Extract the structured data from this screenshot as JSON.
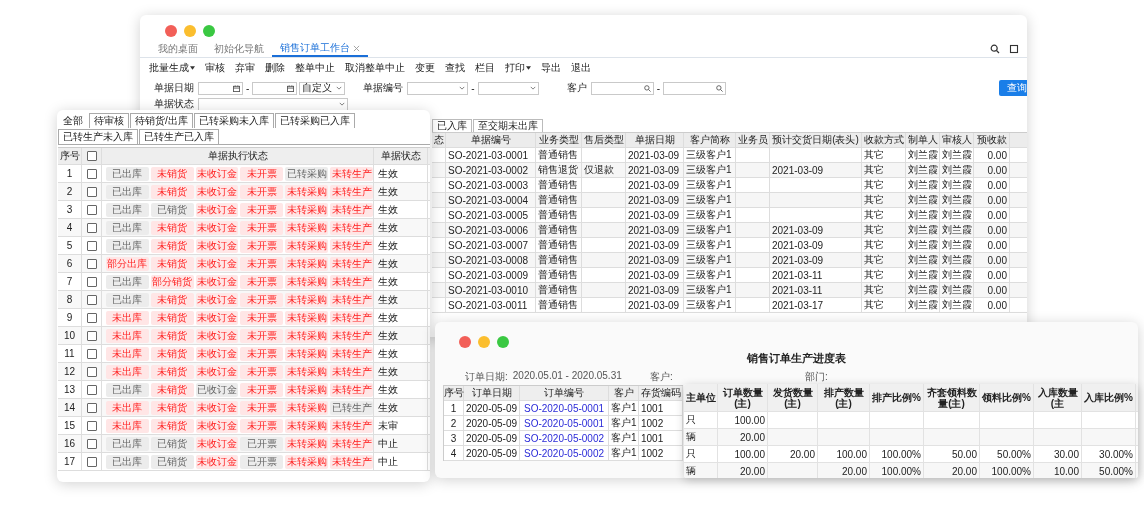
{
  "main_window": {
    "tabs": [
      {
        "label": "我的桌面",
        "selected": false,
        "closable": false
      },
      {
        "label": "初始化导航",
        "selected": false,
        "closable": false
      },
      {
        "label": "销售订单工作台",
        "selected": true,
        "closable": true
      }
    ],
    "toolbar": [
      {
        "label": "批量生成",
        "dropdown": true
      },
      {
        "label": "审核",
        "dropdown": false
      },
      {
        "label": "弃审",
        "dropdown": false
      },
      {
        "label": "删除",
        "dropdown": false
      },
      {
        "label": "整单中止",
        "dropdown": false
      },
      {
        "label": "取消整单中止",
        "dropdown": false
      },
      {
        "label": "变更",
        "dropdown": false
      },
      {
        "label": "查找",
        "dropdown": false
      },
      {
        "label": "栏目",
        "dropdown": false
      },
      {
        "label": "打印",
        "dropdown": true
      },
      {
        "label": "导出",
        "dropdown": false
      },
      {
        "label": "退出",
        "dropdown": false
      }
    ],
    "filters": [
      {
        "label": "单据日期",
        "kind": "date_range",
        "separator": "-",
        "preset": "自定义"
      },
      {
        "label": "单据编号",
        "kind": "select_range",
        "separator": "-"
      },
      {
        "label": "客户",
        "kind": "search_range",
        "separator": "-"
      },
      {
        "label": "单据状态",
        "kind": "select"
      }
    ],
    "query_button": "查询",
    "status_tabs": [
      {
        "label": "已入库",
        "selected": false
      },
      {
        "label": "至交期未出库",
        "selected": false
      }
    ],
    "table": {
      "columns": [
        "态",
        "单据编号",
        "业务类型",
        "售后类型",
        "单据日期",
        "客户简称",
        "业务员",
        "预计交货日期(表头)",
        "收款方式",
        "制单人",
        "审核人",
        "预收款"
      ],
      "rows": [
        [
          "",
          "SO-2021-03-0001",
          "普通销售",
          "",
          "2021-03-09",
          "三级客户1",
          "",
          "",
          "其它",
          "刘兰霞",
          "刘兰霞",
          "0.00"
        ],
        [
          "",
          "SO-2021-03-0002",
          "销售退货",
          "仅退款",
          "2021-03-09",
          "三级客户1",
          "",
          "2021-03-09",
          "其它",
          "刘兰霞",
          "刘兰霞",
          "0.00"
        ],
        [
          "",
          "SO-2021-03-0003",
          "普通销售",
          "",
          "2021-03-09",
          "三级客户1",
          "",
          "",
          "其它",
          "刘兰霞",
          "刘兰霞",
          "0.00"
        ],
        [
          "",
          "SO-2021-03-0004",
          "普通销售",
          "",
          "2021-03-09",
          "三级客户1",
          "",
          "",
          "其它",
          "刘兰霞",
          "刘兰霞",
          "0.00"
        ],
        [
          "",
          "SO-2021-03-0005",
          "普通销售",
          "",
          "2021-03-09",
          "三级客户1",
          "",
          "",
          "其它",
          "刘兰霞",
          "刘兰霞",
          "0.00"
        ],
        [
          "",
          "SO-2021-03-0006",
          "普通销售",
          "",
          "2021-03-09",
          "三级客户1",
          "",
          "2021-03-09",
          "其它",
          "刘兰霞",
          "刘兰霞",
          "0.00"
        ],
        [
          "",
          "SO-2021-03-0007",
          "普通销售",
          "",
          "2021-03-09",
          "三级客户1",
          "",
          "2021-03-09",
          "其它",
          "刘兰霞",
          "刘兰霞",
          "0.00"
        ],
        [
          "",
          "SO-2021-03-0008",
          "普通销售",
          "",
          "2021-03-09",
          "三级客户1",
          "",
          "2021-03-09",
          "其它",
          "刘兰霞",
          "刘兰霞",
          "0.00"
        ],
        [
          "",
          "SO-2021-03-0009",
          "普通销售",
          "",
          "2021-03-09",
          "三级客户1",
          "",
          "2021-03-11",
          "其它",
          "刘兰霞",
          "刘兰霞",
          "0.00"
        ],
        [
          "",
          "SO-2021-03-0010",
          "普通销售",
          "",
          "2021-03-09",
          "三级客户1",
          "",
          "2021-03-11",
          "其它",
          "刘兰霞",
          "刘兰霞",
          "0.00"
        ],
        [
          "",
          "SO-2021-03-0011",
          "普通销售",
          "",
          "2021-03-09",
          "三级客户1",
          "",
          "2021-03-17",
          "其它",
          "刘兰霞",
          "刘兰霞",
          "0.00"
        ]
      ]
    }
  },
  "status_panel": {
    "tabs": [
      {
        "label": "全部",
        "selected": true
      },
      {
        "label": "待审核",
        "selected": false
      },
      {
        "label": "待销货/出库",
        "selected": false
      },
      {
        "label": "已转采购未入库",
        "selected": false
      },
      {
        "label": "已转采购已入库",
        "selected": false
      },
      {
        "label": "已转生产未入库",
        "selected": false
      },
      {
        "label": "已转生产已入库",
        "selected": false
      }
    ],
    "columns": [
      "序号",
      "单据执行状态",
      "单据状态"
    ],
    "select_all_checked": false,
    "rows": [
      {
        "no": "1",
        "checked": false,
        "status": "生效",
        "tags": [
          {
            "text": "已出库",
            "done": true
          },
          {
            "text": "未销货",
            "done": false
          },
          {
            "text": "未收订金",
            "done": false
          },
          {
            "text": "未开票",
            "done": false
          },
          {
            "text": "已转采购",
            "done": true
          },
          {
            "text": "未转生产",
            "done": false
          }
        ]
      },
      {
        "no": "2",
        "checked": false,
        "status": "生效",
        "tags": [
          {
            "text": "已出库",
            "done": true
          },
          {
            "text": "未销货",
            "done": false
          },
          {
            "text": "未收订金",
            "done": false
          },
          {
            "text": "未开票",
            "done": false
          },
          {
            "text": "未转采购",
            "done": false
          },
          {
            "text": "未转生产",
            "done": false
          }
        ]
      },
      {
        "no": "3",
        "checked": false,
        "status": "生效",
        "tags": [
          {
            "text": "已出库",
            "done": true
          },
          {
            "text": "已销货",
            "done": true
          },
          {
            "text": "未收订金",
            "done": false
          },
          {
            "text": "未开票",
            "done": false
          },
          {
            "text": "未转采购",
            "done": false
          },
          {
            "text": "未转生产",
            "done": false
          }
        ]
      },
      {
        "no": "4",
        "checked": false,
        "status": "生效",
        "tags": [
          {
            "text": "已出库",
            "done": true
          },
          {
            "text": "未销货",
            "done": false
          },
          {
            "text": "未收订金",
            "done": false
          },
          {
            "text": "未开票",
            "done": false
          },
          {
            "text": "未转采购",
            "done": false
          },
          {
            "text": "未转生产",
            "done": false
          }
        ]
      },
      {
        "no": "5",
        "checked": false,
        "status": "生效",
        "tags": [
          {
            "text": "已出库",
            "done": true
          },
          {
            "text": "未销货",
            "done": false
          },
          {
            "text": "未收订金",
            "done": false
          },
          {
            "text": "未开票",
            "done": false
          },
          {
            "text": "未转采购",
            "done": false
          },
          {
            "text": "未转生产",
            "done": false
          }
        ]
      },
      {
        "no": "6",
        "checked": false,
        "status": "生效",
        "tags": [
          {
            "text": "部分出库",
            "done": false
          },
          {
            "text": "未销货",
            "done": false
          },
          {
            "text": "未收订金",
            "done": false
          },
          {
            "text": "未开票",
            "done": false
          },
          {
            "text": "未转采购",
            "done": false
          },
          {
            "text": "未转生产",
            "done": false
          }
        ]
      },
      {
        "no": "7",
        "checked": false,
        "status": "生效",
        "tags": [
          {
            "text": "已出库",
            "done": true
          },
          {
            "text": "部分销货",
            "done": false
          },
          {
            "text": "未收订金",
            "done": false
          },
          {
            "text": "未开票",
            "done": false
          },
          {
            "text": "未转采购",
            "done": false
          },
          {
            "text": "未转生产",
            "done": false
          }
        ]
      },
      {
        "no": "8",
        "checked": false,
        "status": "生效",
        "tags": [
          {
            "text": "已出库",
            "done": true
          },
          {
            "text": "未销货",
            "done": false
          },
          {
            "text": "未收订金",
            "done": false
          },
          {
            "text": "未开票",
            "done": false
          },
          {
            "text": "未转采购",
            "done": false
          },
          {
            "text": "未转生产",
            "done": false
          }
        ]
      },
      {
        "no": "9",
        "checked": false,
        "status": "生效",
        "tags": [
          {
            "text": "未出库",
            "done": false
          },
          {
            "text": "未销货",
            "done": false
          },
          {
            "text": "未收订金",
            "done": false
          },
          {
            "text": "未开票",
            "done": false
          },
          {
            "text": "未转采购",
            "done": false
          },
          {
            "text": "未转生产",
            "done": false
          }
        ]
      },
      {
        "no": "10",
        "checked": false,
        "status": "生效",
        "tags": [
          {
            "text": "未出库",
            "done": false
          },
          {
            "text": "未销货",
            "done": false
          },
          {
            "text": "未收订金",
            "done": false
          },
          {
            "text": "未开票",
            "done": false
          },
          {
            "text": "未转采购",
            "done": false
          },
          {
            "text": "未转生产",
            "done": false
          }
        ]
      },
      {
        "no": "11",
        "checked": false,
        "status": "生效",
        "tags": [
          {
            "text": "未出库",
            "done": false
          },
          {
            "text": "未销货",
            "done": false
          },
          {
            "text": "未收订金",
            "done": false
          },
          {
            "text": "未开票",
            "done": false
          },
          {
            "text": "未转采购",
            "done": false
          },
          {
            "text": "未转生产",
            "done": false
          }
        ]
      },
      {
        "no": "12",
        "checked": false,
        "status": "生效",
        "tags": [
          {
            "text": "未出库",
            "done": false
          },
          {
            "text": "未销货",
            "done": false
          },
          {
            "text": "未收订金",
            "done": false
          },
          {
            "text": "未开票",
            "done": false
          },
          {
            "text": "未转采购",
            "done": false
          },
          {
            "text": "未转生产",
            "done": false
          }
        ]
      },
      {
        "no": "13",
        "checked": false,
        "status": "生效",
        "tags": [
          {
            "text": "已出库",
            "done": true
          },
          {
            "text": "未销货",
            "done": false
          },
          {
            "text": "已收订金",
            "done": true
          },
          {
            "text": "未开票",
            "done": false
          },
          {
            "text": "未转采购",
            "done": false
          },
          {
            "text": "未转生产",
            "done": false
          }
        ]
      },
      {
        "no": "14",
        "checked": false,
        "status": "生效",
        "tags": [
          {
            "text": "未出库",
            "done": false
          },
          {
            "text": "未销货",
            "done": false
          },
          {
            "text": "未收订金",
            "done": false
          },
          {
            "text": "未开票",
            "done": false
          },
          {
            "text": "未转采购",
            "done": false
          },
          {
            "text": "已转生产",
            "done": true
          }
        ]
      },
      {
        "no": "15",
        "checked": false,
        "status": "未审",
        "tags": [
          {
            "text": "未出库",
            "done": false
          },
          {
            "text": "未销货",
            "done": false
          },
          {
            "text": "未收订金",
            "done": false
          },
          {
            "text": "未开票",
            "done": false
          },
          {
            "text": "未转采购",
            "done": false
          },
          {
            "text": "未转生产",
            "done": false
          }
        ]
      },
      {
        "no": "16",
        "checked": false,
        "status": "中止",
        "tags": [
          {
            "text": "已出库",
            "done": true
          },
          {
            "text": "已销货",
            "done": true
          },
          {
            "text": "未收订金",
            "done": false
          },
          {
            "text": "已开票",
            "done": true
          },
          {
            "text": "未转采购",
            "done": false
          },
          {
            "text": "未转生产",
            "done": false
          }
        ]
      },
      {
        "no": "17",
        "checked": false,
        "status": "中止",
        "tags": [
          {
            "text": "已出库",
            "done": true
          },
          {
            "text": "已销货",
            "done": true
          },
          {
            "text": "未收订金",
            "done": false
          },
          {
            "text": "已开票",
            "done": true
          },
          {
            "text": "未转采购",
            "done": false
          },
          {
            "text": "未转生产",
            "done": false
          }
        ]
      }
    ]
  },
  "report_window": {
    "title": "销售订单生产进度表",
    "filters": [
      {
        "label": "订单日期:",
        "value": "2020.05.01 - 2020.05.31"
      },
      {
        "label": "客户:"
      },
      {
        "label": "部门:"
      }
    ],
    "table": {
      "columns": [
        "序号",
        "订单日期",
        "订单编号",
        "客户",
        "存货编码"
      ],
      "rows": [
        [
          "1",
          "2020-05-09",
          "SO-2020-05-0001",
          "客户1",
          "1001"
        ],
        [
          "2",
          "2020-05-09",
          "SO-2020-05-0001",
          "客户1",
          "1002"
        ],
        [
          "3",
          "2020-05-09",
          "SO-2020-05-0002",
          "客户1",
          "1001"
        ],
        [
          "4",
          "2020-05-09",
          "SO-2020-05-0002",
          "客户1",
          "1002"
        ]
      ]
    }
  },
  "report_detail": {
    "columns": [
      "主单位",
      "订单数量(主)",
      "发货数量(主)",
      "排产数量(主)",
      "排产比例%",
      "齐套领料数量(主)",
      "领料比例%",
      "入库数量(主",
      "入库比例%"
    ],
    "rows": [
      [
        "只",
        "100.00",
        "",
        "",
        "",
        "",
        "",
        "",
        ""
      ],
      [
        "辆",
        "20.00",
        "",
        "",
        "",
        "",
        "",
        "",
        ""
      ],
      [
        "只",
        "100.00",
        "20.00",
        "100.00",
        "100.00%",
        "50.00",
        "50.00%",
        "30.00",
        "30.00%"
      ],
      [
        "辆",
        "20.00",
        "",
        "20.00",
        "100.00%",
        "20.00",
        "100.00%",
        "10.00",
        "50.00%"
      ]
    ]
  }
}
